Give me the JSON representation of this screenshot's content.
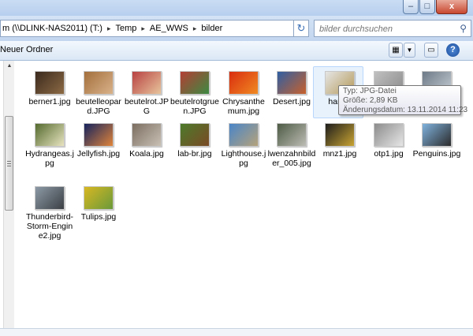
{
  "address": {
    "crumbs": [
      "m (\\\\DLINK-NAS2011) (T:)",
      "Temp",
      "AE_WWS",
      "bilder"
    ],
    "separator": "▸",
    "refresh_glyph": "↻"
  },
  "search": {
    "placeholder": "bilder durchsuchen"
  },
  "toolbar": {
    "new_folder": "Neuer Ordner",
    "help_glyph": "?"
  },
  "window": {
    "minimize": "–",
    "maximize": "□",
    "close": "x"
  },
  "files": [
    {
      "name": "berner1.jpg",
      "colors": [
        "#3b2a1e",
        "#8c6a44"
      ]
    },
    {
      "name": "beutelleopard.JPG",
      "colors": [
        "#a36f3c",
        "#d9b28a"
      ]
    },
    {
      "name": "beutelrot.JPG",
      "colors": [
        "#b84242",
        "#e7c49c"
      ]
    },
    {
      "name": "beutelrotgruen.JPG",
      "colors": [
        "#b33e35",
        "#3c8a42"
      ]
    },
    {
      "name": "Chrysanthemum.jpg",
      "colors": [
        "#d92d0f",
        "#f08a22"
      ]
    },
    {
      "name": "Desert.jpg",
      "colors": [
        "#2f5fa3",
        "#c8602b"
      ]
    },
    {
      "name": "hamm",
      "colors": [
        "#e5e5e5",
        "#b59a5a"
      ]
    },
    {
      "name": "",
      "colors": [
        "#c0c0c0",
        "#8a8a8a"
      ]
    },
    {
      "name": "",
      "colors": [
        "#6d7a87",
        "#c4ccd3"
      ]
    },
    {
      "name": "Hydrangeas.jpg",
      "colors": [
        "#556b2f",
        "#e8e4c0"
      ]
    },
    {
      "name": "Jellyfish.jpg",
      "colors": [
        "#15235e",
        "#e0843a"
      ]
    },
    {
      "name": "Koala.jpg",
      "colors": [
        "#7b6e61",
        "#c9c1b4"
      ]
    },
    {
      "name": "lab-br.jpg",
      "colors": [
        "#4c7a2b",
        "#7a4a25"
      ]
    },
    {
      "name": "Lighthouse.jpg",
      "colors": [
        "#4a85c8",
        "#b5a27a"
      ]
    },
    {
      "name": "lwenzahnbilder_005.jpg",
      "colors": [
        "#4e5b45",
        "#bcbcb4"
      ]
    },
    {
      "name": "mnz1.jpg",
      "colors": [
        "#1d1d1d",
        "#c9a432"
      ]
    },
    {
      "name": "otp1.jpg",
      "colors": [
        "#8c8c8c",
        "#e6e6e6"
      ]
    },
    {
      "name": "Penguins.jpg",
      "colors": [
        "#7fb2dd",
        "#2b2b2b"
      ]
    },
    {
      "name": "Thunderbird-Storm-Engine2.jpg",
      "colors": [
        "#8c9aa6",
        "#3b3f44"
      ]
    },
    {
      "name": "Tulips.jpg",
      "colors": [
        "#d8b722",
        "#6a9a3a"
      ]
    }
  ],
  "tooltip": {
    "type": "Typ: JPG-Datei",
    "size": "Größe: 2,89 KB",
    "modified": "Änderungsdatum: 13.11.2014 11:23"
  }
}
